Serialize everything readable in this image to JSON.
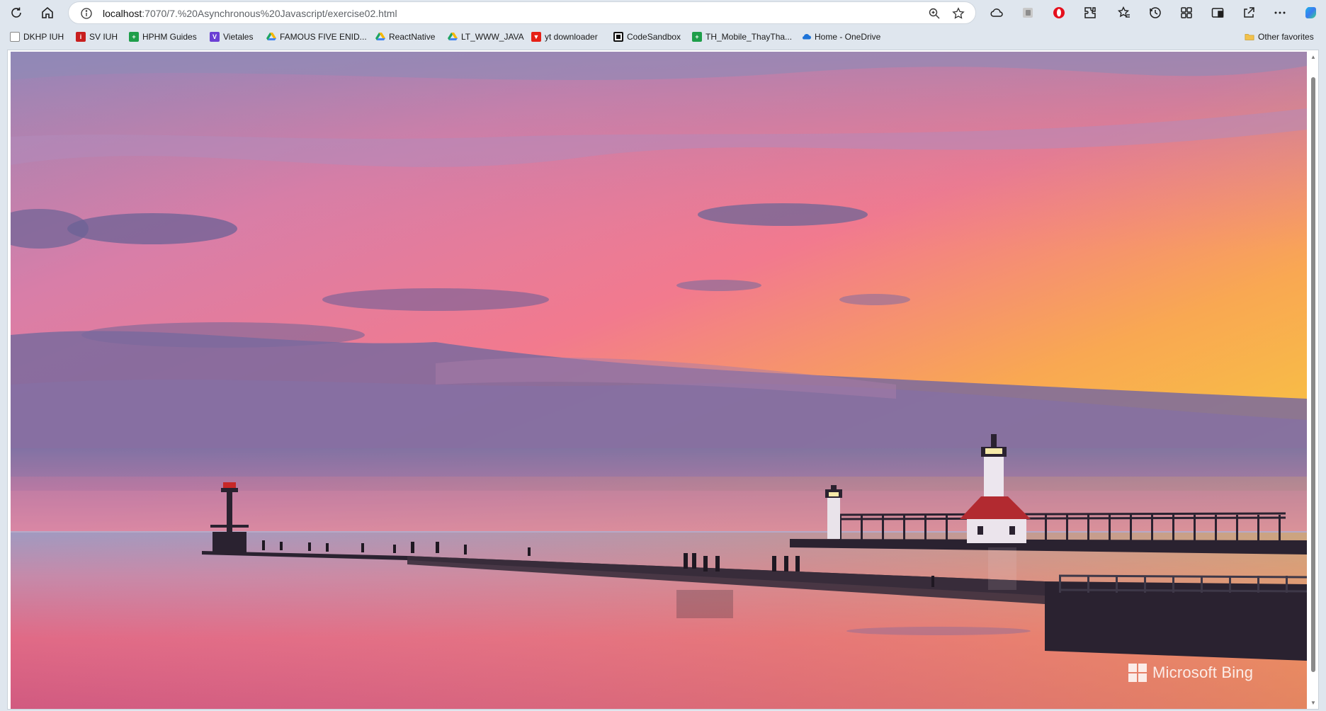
{
  "browser": {
    "url_host": "localhost",
    "url_rest": ":7070/7.%20Asynchronous%20Javascript/exercise02.html",
    "toolbar_icons": [
      "refresh-icon",
      "home-icon",
      "site-info-icon",
      "zoom-icon",
      "favorite-star-icon",
      "cloud-icon",
      "extension-icon",
      "opera-icon",
      "extensions-puzzle-icon",
      "favorites-icon",
      "history-icon",
      "collections-icon",
      "split-screen-icon",
      "share-icon",
      "more-icon",
      "copilot-icon"
    ]
  },
  "bookmarks": [
    {
      "label": "DKHP IUH",
      "icon": "page-icon"
    },
    {
      "label": "SV IUH",
      "icon": "iuh-icon"
    },
    {
      "label": "HPHM Guides",
      "icon": "sheets-icon"
    },
    {
      "label": "Vietales",
      "icon": "vietales-icon"
    },
    {
      "label": "FAMOUS FIVE ENID...",
      "icon": "drive-icon"
    },
    {
      "label": "ReactNative",
      "icon": "drive-icon"
    },
    {
      "label": "LT_WWW_JAVA",
      "icon": "drive-icon"
    },
    {
      "label": "yt downloader",
      "icon": "youtube-icon"
    },
    {
      "label": "CodeSandbox",
      "icon": "codesandbox-icon"
    },
    {
      "label": "TH_Mobile_ThayTha...",
      "icon": "sheets-icon"
    },
    {
      "label": "Home - OneDrive",
      "icon": "onedrive-icon"
    }
  ],
  "other_favorites": "Other favorites",
  "page": {
    "image_watermark": "Microsoft Bing"
  },
  "colors": {
    "browser_chrome": "#dfe6ee",
    "sky_top": "#8a7cb0",
    "sky_pink": "#f07898",
    "sky_orange": "#f8a050",
    "sky_yellow": "#f8d038",
    "water": "#c27a9a"
  }
}
